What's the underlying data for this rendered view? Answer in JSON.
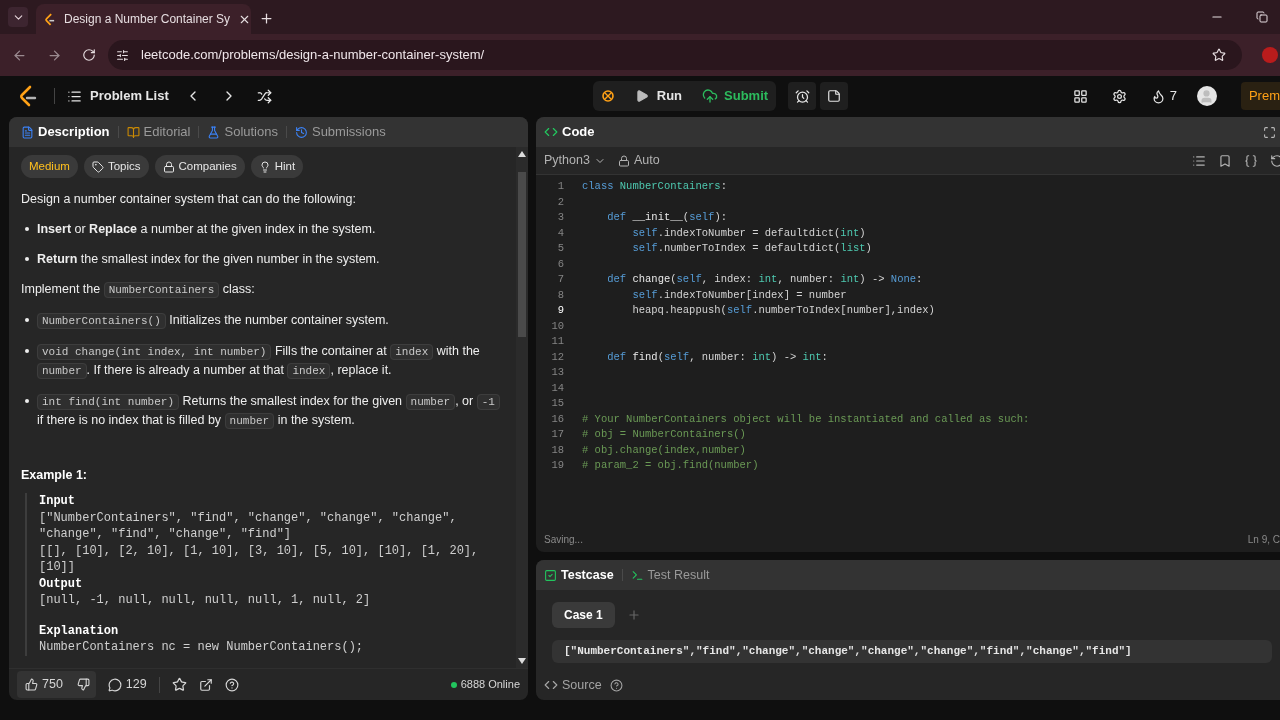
{
  "browser": {
    "tab_title": "Design a Number Container Sy",
    "url": "leetcode.com/problems/design-a-number-container-system/"
  },
  "navbar": {
    "problem_list": "Problem List",
    "run": "Run",
    "submit": "Submit",
    "streak": "7",
    "premium": "Prem"
  },
  "left_panel": {
    "tabs": [
      {
        "label": "Description",
        "selected": true
      },
      {
        "label": "Editorial",
        "selected": false
      },
      {
        "label": "Solutions",
        "selected": false
      },
      {
        "label": "Submissions",
        "selected": false
      }
    ],
    "tags": [
      {
        "label": "Medium",
        "kind": "difficulty"
      },
      {
        "label": "Topics",
        "kind": "topics"
      },
      {
        "label": "Companies",
        "kind": "companies"
      },
      {
        "label": "Hint",
        "kind": "hint"
      }
    ],
    "description": [
      {
        "kind": "paragraph",
        "parts": [
          {
            "kind": "text",
            "t": "Design a number container system that can do the following:"
          }
        ]
      },
      {
        "kind": "bullet",
        "parts": [
          {
            "kind": "text",
            "t": "**Insert** or **Replace** a number at the given index in the system."
          }
        ]
      },
      {
        "kind": "bullet",
        "parts": [
          {
            "kind": "text",
            "t": "**Return** the smallest index for the given number in the system."
          }
        ]
      },
      {
        "kind": "paragraph",
        "parts": [
          {
            "kind": "text",
            "t": "Implement the "
          },
          {
            "kind": "code",
            "t": "NumberContainers"
          },
          {
            "kind": "text",
            "t": " class:"
          }
        ]
      },
      {
        "kind": "bullet",
        "parts": [
          {
            "kind": "code",
            "t": "NumberContainers()"
          },
          {
            "kind": "text",
            "t": " Initializes the number container system."
          }
        ]
      },
      {
        "kind": "bullet",
        "parts": [
          {
            "kind": "code",
            "t": "void change(int index, int number)"
          },
          {
            "kind": "text",
            "t": " Fills the container at "
          },
          {
            "kind": "code",
            "t": "index"
          },
          {
            "kind": "text",
            "t": " with the "
          },
          {
            "kind": "code",
            "t": "number"
          },
          {
            "kind": "text",
            "t": ". If there is already a number at that "
          },
          {
            "kind": "code",
            "t": "index"
          },
          {
            "kind": "text",
            "t": ", replace it."
          }
        ]
      },
      {
        "kind": "bullet",
        "parts": [
          {
            "kind": "code",
            "t": "int find(int number)"
          },
          {
            "kind": "text",
            "t": " Returns the smallest index for the given "
          },
          {
            "kind": "code",
            "t": "number"
          },
          {
            "kind": "text",
            "t": ", or "
          },
          {
            "kind": "code",
            "t": "-1"
          },
          {
            "kind": "text",
            "t": " if there is no index that is filled by "
          },
          {
            "kind": "code",
            "t": "number"
          },
          {
            "kind": "text",
            "t": " in the system."
          }
        ]
      }
    ],
    "example": {
      "title": "Example 1:",
      "lines": [
        {
          "kind": "label",
          "t": "Input"
        },
        {
          "kind": "text",
          "t": "[\"NumberContainers\", \"find\", \"change\", \"change\", \"change\", \"change\", \"find\", \"change\", \"find\"]"
        },
        {
          "kind": "text",
          "t": "[[], [10], [2, 10], [1, 10], [3, 10], [5, 10], [10], [1, 20], [10]]"
        },
        {
          "kind": "label",
          "t": "Output"
        },
        {
          "kind": "text",
          "t": "[null, -1, null, null, null, null, 1, null, 2]"
        },
        {
          "kind": "gap"
        },
        {
          "kind": "label",
          "t": "Explanation"
        },
        {
          "kind": "text",
          "t": "NumberContainers nc = new NumberContainers();"
        }
      ]
    },
    "footer": {
      "likes": "750",
      "comments": "129",
      "online": "6888 Online"
    }
  },
  "code_panel": {
    "title": "Code",
    "language": "Python3",
    "auto": "Auto",
    "status": "Saving...",
    "position": "Ln 9, C",
    "lines": [
      {
        "n": "1",
        "active": false,
        "tokens": [
          {
            "kind": "kw",
            "t": "class "
          },
          {
            "kind": "cls",
            "t": "NumberContainers"
          },
          {
            "kind": "plain",
            "t": ":"
          }
        ]
      },
      {
        "n": "2",
        "active": false
      },
      {
        "n": "3",
        "active": false,
        "tokens": [
          {
            "kind": "kw",
            "t": "    def "
          },
          {
            "kind": "fn",
            "t": "__init__"
          },
          {
            "kind": "plain",
            "t": "("
          },
          {
            "kind": "self",
            "t": "self"
          },
          {
            "kind": "plain",
            "t": "):"
          }
        ]
      },
      {
        "n": "4",
        "active": false,
        "tokens": [
          {
            "kind": "self",
            "t": "        self"
          },
          {
            "kind": "plain",
            "t": ".indexToNumber = defaultdict("
          },
          {
            "kind": "type",
            "t": "int"
          },
          {
            "kind": "plain",
            "t": ")"
          }
        ]
      },
      {
        "n": "5",
        "active": false,
        "tokens": [
          {
            "kind": "self",
            "t": "        self"
          },
          {
            "kind": "plain",
            "t": ".numberToIndex = defaultdict("
          },
          {
            "kind": "type",
            "t": "list"
          },
          {
            "kind": "plain",
            "t": ")"
          }
        ]
      },
      {
        "n": "6",
        "active": false
      },
      {
        "n": "7",
        "active": false,
        "tokens": [
          {
            "kind": "kw",
            "t": "    def "
          },
          {
            "kind": "fn",
            "t": "change"
          },
          {
            "kind": "plain",
            "t": "("
          },
          {
            "kind": "self",
            "t": "self"
          },
          {
            "kind": "plain",
            "t": ", index: "
          },
          {
            "kind": "type",
            "t": "int"
          },
          {
            "kind": "plain",
            "t": ", number: "
          },
          {
            "kind": "type",
            "t": "int"
          },
          {
            "kind": "plain",
            "t": ") -> "
          },
          {
            "kind": "kw",
            "t": "None"
          },
          {
            "kind": "plain",
            "t": ":"
          }
        ]
      },
      {
        "n": "8",
        "active": false,
        "tokens": [
          {
            "kind": "self",
            "t": "        self"
          },
          {
            "kind": "plain",
            "t": ".indexToNumber[index] = number"
          }
        ]
      },
      {
        "n": "9",
        "active": true,
        "tokens": [
          {
            "kind": "plain",
            "t": "        heapq.heappush("
          },
          {
            "kind": "self",
            "t": "self"
          },
          {
            "kind": "plain",
            "t": ".numberToIndex[number],index)"
          }
        ]
      },
      {
        "n": "10",
        "active": false
      },
      {
        "n": "11",
        "active": false
      },
      {
        "n": "12",
        "active": false,
        "tokens": [
          {
            "kind": "kw",
            "t": "    def "
          },
          {
            "kind": "fn",
            "t": "find"
          },
          {
            "kind": "plain",
            "t": "("
          },
          {
            "kind": "self",
            "t": "self"
          },
          {
            "kind": "plain",
            "t": ", number: "
          },
          {
            "kind": "type",
            "t": "int"
          },
          {
            "kind": "plain",
            "t": ") -> "
          },
          {
            "kind": "type",
            "t": "int"
          },
          {
            "kind": "plain",
            "t": ":"
          }
        ]
      },
      {
        "n": "13",
        "active": false
      },
      {
        "n": "14",
        "active": false
      },
      {
        "n": "15",
        "active": false
      },
      {
        "n": "16",
        "active": false,
        "tokens": [
          {
            "kind": "comment",
            "t": "# Your NumberContainers object will be instantiated and called as such:"
          }
        ]
      },
      {
        "n": "17",
        "active": false,
        "tokens": [
          {
            "kind": "comment",
            "t": "# obj = NumberContainers()"
          }
        ]
      },
      {
        "n": "18",
        "active": false,
        "tokens": [
          {
            "kind": "comment",
            "t": "# obj.change(index,number)"
          }
        ]
      },
      {
        "n": "19",
        "active": false,
        "tokens": [
          {
            "kind": "comment",
            "t": "# param_2 = obj.find(number)"
          }
        ]
      }
    ]
  },
  "test_panel": {
    "tabs": [
      {
        "label": "Testcase",
        "kind": "testcase",
        "selected": true
      },
      {
        "label": "Test Result",
        "kind": "result",
        "selected": false
      }
    ],
    "cases": [
      {
        "label": "Case 1",
        "selected": true
      }
    ],
    "input": "[\"NumberContainers\",\"find\",\"change\",\"change\",\"change\",\"change\",\"find\",\"change\",\"find\"]",
    "source": "Source"
  }
}
